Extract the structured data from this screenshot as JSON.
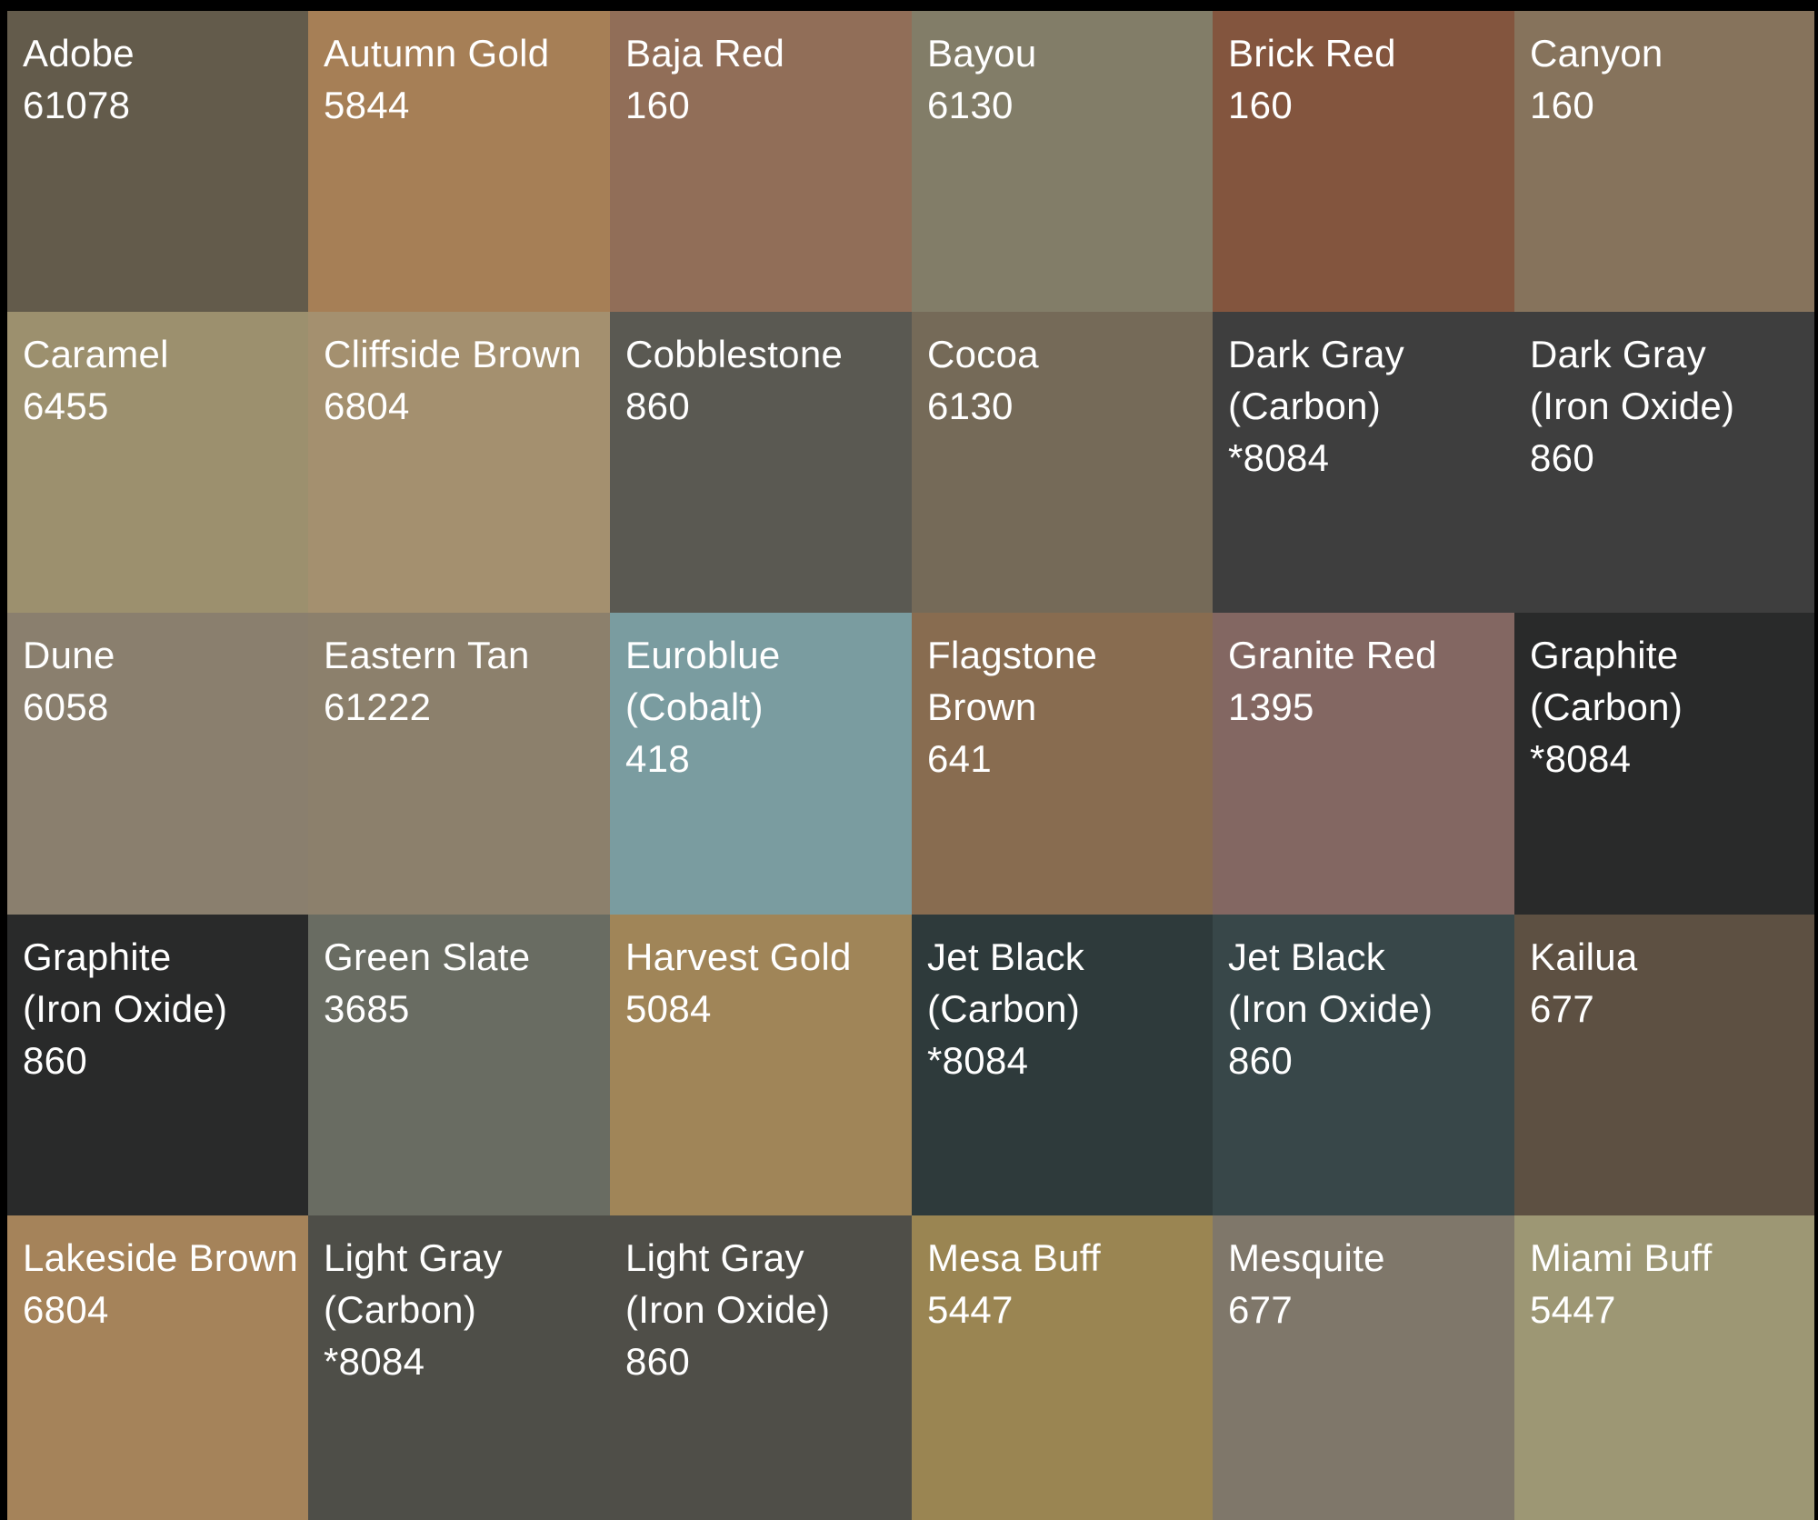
{
  "swatches": [
    {
      "lines": [
        "Adobe",
        "61078"
      ],
      "color": "#635b4b"
    },
    {
      "lines": [
        "Autumn Gold",
        "5844"
      ],
      "color": "#a67f56"
    },
    {
      "lines": [
        "Baja Red",
        "160"
      ],
      "color": "#916e58"
    },
    {
      "lines": [
        "Bayou",
        "6130"
      ],
      "color": "#827d68"
    },
    {
      "lines": [
        "Brick Red",
        "160"
      ],
      "color": "#83553e"
    },
    {
      "lines": [
        "Canyon",
        "160"
      ],
      "color": "#86735c"
    },
    {
      "lines": [
        "Caramel",
        "6455"
      ],
      "color": "#9c906e"
    },
    {
      "lines": [
        "Cliffside Brown",
        "6804"
      ],
      "color": "#a4906f"
    },
    {
      "lines": [
        "Cobblestone",
        "860"
      ],
      "color": "#5a5952"
    },
    {
      "lines": [
        "Cocoa",
        "6130"
      ],
      "color": "#756a58"
    },
    {
      "lines": [
        "Dark Gray",
        "(Carbon)",
        "*8084"
      ],
      "color": "#3e3e3e"
    },
    {
      "lines": [
        "Dark Gray",
        "(Iron Oxide)",
        "860"
      ],
      "color": "#3e3e3e"
    },
    {
      "lines": [
        "Dune",
        "6058"
      ],
      "color": "#8a7f6e"
    },
    {
      "lines": [
        "Eastern Tan",
        "61222"
      ],
      "color": "#8c806c"
    },
    {
      "lines": [
        "Euroblue",
        "(Cobalt)",
        "418"
      ],
      "color": "#7a9ca0"
    },
    {
      "lines": [
        "Flagstone",
        "Brown",
        "641"
      ],
      "color": "#886c50"
    },
    {
      "lines": [
        "Granite Red",
        "1395"
      ],
      "color": "#836762"
    },
    {
      "lines": [
        "Graphite",
        "(Carbon)",
        "*8084"
      ],
      "color": "#292a2a"
    },
    {
      "lines": [
        "Graphite",
        "(Iron Oxide)",
        "860"
      ],
      "color": "#292a2a"
    },
    {
      "lines": [
        "Green Slate",
        "3685"
      ],
      "color": "#696c62"
    },
    {
      "lines": [
        "Harvest Gold",
        "5084"
      ],
      "color": "#a08558"
    },
    {
      "lines": [
        "Jet Black",
        "(Carbon)",
        "*8084"
      ],
      "color": "#2e3a3b"
    },
    {
      "lines": [
        "Jet Black",
        "(Iron Oxide)",
        "860"
      ],
      "color": "#384749"
    },
    {
      "lines": [
        "Kailua",
        "677"
      ],
      "color": "#5d5042"
    },
    {
      "lines": [
        "Lakeside Brown",
        "6804"
      ],
      "color": "#a5835a"
    },
    {
      "lines": [
        "Light Gray",
        "(Carbon)",
        "*8084"
      ],
      "color": "#4e4e48"
    },
    {
      "lines": [
        "Light Gray",
        "(Iron Oxide)",
        "860"
      ],
      "color": "#4f4e48"
    },
    {
      "lines": [
        "Mesa Buff",
        "5447"
      ],
      "color": "#9a8552"
    },
    {
      "lines": [
        "Mesquite",
        "677"
      ],
      "color": "#7f776a"
    },
    {
      "lines": [
        "Miami Buff",
        "5447"
      ],
      "color": "#9d9774"
    }
  ]
}
